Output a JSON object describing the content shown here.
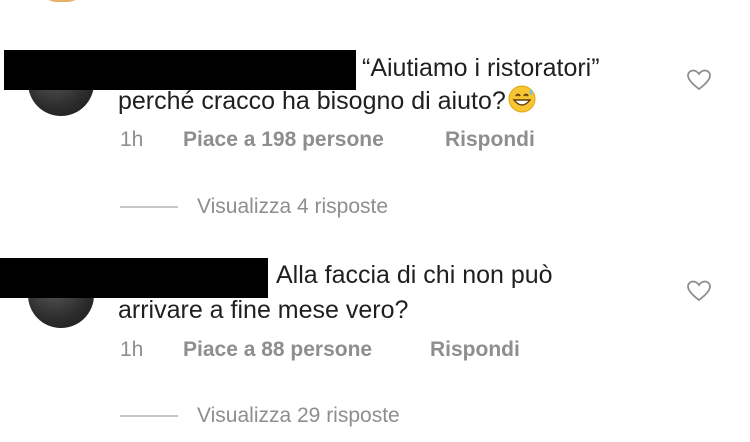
{
  "comments": [
    {
      "text_line1": "“Aiutiamo i ristoratori”",
      "text_line2": "perché cracco ha bisogno di aiuto?",
      "emoji_icon": "grinning-sweat-emoji",
      "time": "1h",
      "likes": "Piace a 198 persone",
      "reply": "Rispondi",
      "view_replies": "Visualizza 4 risposte"
    },
    {
      "text_line1": "Alla faccia di chi non può",
      "text_line2": "arrivare a fine mese vero?",
      "time": "1h",
      "likes": "Piace a 88 persone",
      "reply": "Rispondi",
      "view_replies": "Visualizza 29 risposte"
    }
  ],
  "colors": {
    "text": "#1f1f1f",
    "meta": "#8e8e8e",
    "redaction": "#000000",
    "background": "#ffffff"
  }
}
